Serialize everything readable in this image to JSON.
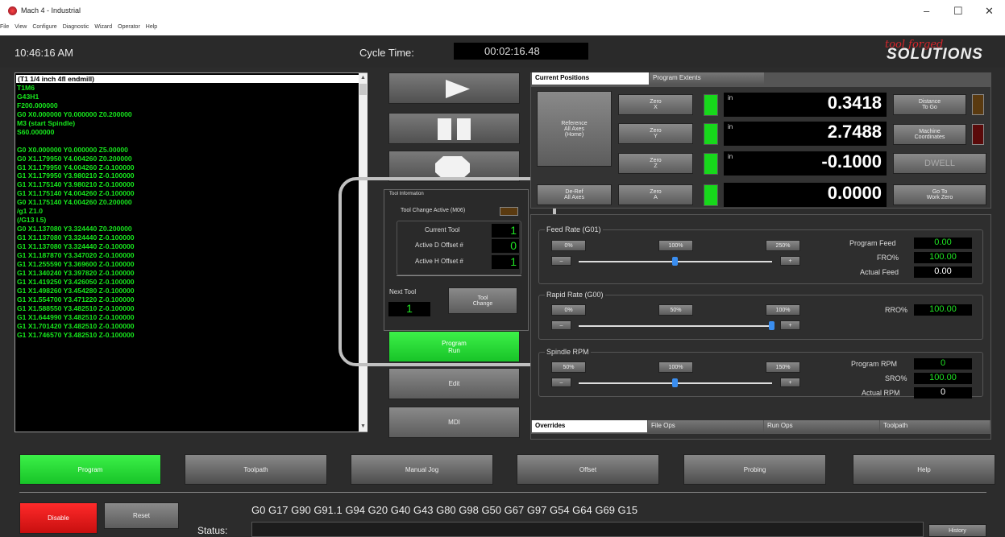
{
  "window": {
    "title": "Mach 4 - Industrial",
    "minimize": "–",
    "maximize": "☐",
    "close": "✕"
  },
  "menu": [
    "File",
    "View",
    "Configure",
    "Diagnostic",
    "Wizard",
    "Operator",
    "Help"
  ],
  "topbar": {
    "clock": "10:46:16 AM",
    "cycle_label": "Cycle Time:",
    "cycle_value": "00:02:16.48",
    "logo_top": "tool forged",
    "logo_bottom": "SOLUTIONS"
  },
  "gcode": [
    "(T1 1/4 inch 4fl endmill)",
    "T1M6",
    "G43H1",
    "F200.000000",
    "G0 X0.000000 Y0.000000 Z0.200000",
    "M3 (start Spindle)",
    "S60.000000",
    "",
    "G0 X0.000000 Y0.000000 Z5.00000",
    "G0 X1.179950 Y4.004260 Z0.200000",
    "G1 X1.179950 Y4.004260 Z-0.100000",
    "G1 X1.179950 Y3.980210 Z-0.100000",
    "G1 X1.175140 Y3.980210 Z-0.100000",
    "G1 X1.175140 Y4.004260 Z-0.100000",
    "G0 X1.175140 Y4.004260 Z0.200000",
    "/g1 Z1.0",
    "(/G13 I.5)",
    "G0 X1.137080 Y3.324440 Z0.200000",
    "G1 X1.137080 Y3.324440 Z-0.100000",
    "G1 X1.137080 Y3.324440 Z-0.100000",
    "G1 X1.187870 Y3.347020 Z-0.100000",
    "G1 X1.255590 Y3.369600 Z-0.100000",
    "G1 X1.340240 Y3.397820 Z-0.100000",
    "G1 X1.419250 Y3.426050 Z-0.100000",
    "G1 X1.498260 Y3.454280 Z-0.100000",
    "G1 X1.554700 Y3.471220 Z-0.100000",
    "G1 X1.588550 Y3.482510 Z-0.100000",
    "G1 X1.644990 Y3.482510 Z-0.100000",
    "G1 X1.701420 Y3.482510 Z-0.100000",
    "G1 X1.746570 Y3.482510 Z-0.100000"
  ],
  "controls": {
    "program_run": "Program\nRun",
    "edit": "Edit",
    "mdi": "MDI"
  },
  "tool_info": {
    "title": "Tool Information",
    "tool_change_active": "Tool Change Active (M06)",
    "current_tool_label": "Current Tool",
    "current_tool": "1",
    "d_offset_label": "Active D Offset #",
    "d_offset": "0",
    "h_offset_label": "Active H Offset #",
    "h_offset": "1",
    "next_tool_label": "Next Tool",
    "next_tool": "1",
    "tool_change_button": "Tool\nChange"
  },
  "positions": {
    "tabs": [
      "Current Positions",
      "Program Extents"
    ],
    "ref_all": "Reference\nAll Axes\n(Home)",
    "deref_all": "De-Ref\nAll Axes",
    "unit": "in",
    "axes": [
      {
        "zero": "Zero\nX",
        "value": "0.3418"
      },
      {
        "zero": "Zero\nY",
        "value": "2.7488"
      },
      {
        "zero": "Zero\nZ",
        "value": "-0.1000"
      },
      {
        "zero": "Zero\nA",
        "value": "0.0000"
      }
    ],
    "distance_to_go": "Distance\nTo Go",
    "machine_coords": "Machine\nCoordinates",
    "dwell": "DWELL",
    "goto_work_zero": "Go To\nWork Zero"
  },
  "feed": {
    "title": "Feed Rate (G01)",
    "btns": [
      "0%",
      "100%",
      "250%"
    ],
    "minus": "–",
    "plus": "+",
    "program_feed_label": "Program Feed",
    "program_feed": "0.00",
    "fro_label": "FRO%",
    "fro": "100.00",
    "actual_feed_label": "Actual Feed",
    "actual_feed": "0.00",
    "fro_pct": 0.5
  },
  "rapid": {
    "title": "Rapid Rate (G00)",
    "btns": [
      "0%",
      "50%",
      "100%"
    ],
    "minus": "–",
    "plus": "+",
    "rro_label": "RRO%",
    "rro": "100.00",
    "rro_pct": 1.0
  },
  "spindle": {
    "title": "Spindle RPM",
    "btns": [
      "50%",
      "100%",
      "150%"
    ],
    "minus": "–",
    "plus": "+",
    "program_rpm_label": "Program RPM",
    "program_rpm": "0",
    "sro_label": "SRO%",
    "sro": "100.00",
    "actual_rpm_label": "Actual RPM",
    "actual_rpm": "0",
    "sro_pct": 0.5
  },
  "bottom_tabs": [
    "Overrides",
    "File Ops",
    "Run Ops",
    "Toolpath"
  ],
  "nav": [
    "Program",
    "Toolpath",
    "Manual Jog",
    "Offset",
    "Probing",
    "Help"
  ],
  "footer": {
    "disable": "Disable",
    "reset": "Reset",
    "modal_codes": "G0 G17 G90 G91.1 G94 G20 G40 G43 G80 G98 G50 G67 G97 G54 G64 G69 G15",
    "status_label": "Status:",
    "history": "History"
  }
}
